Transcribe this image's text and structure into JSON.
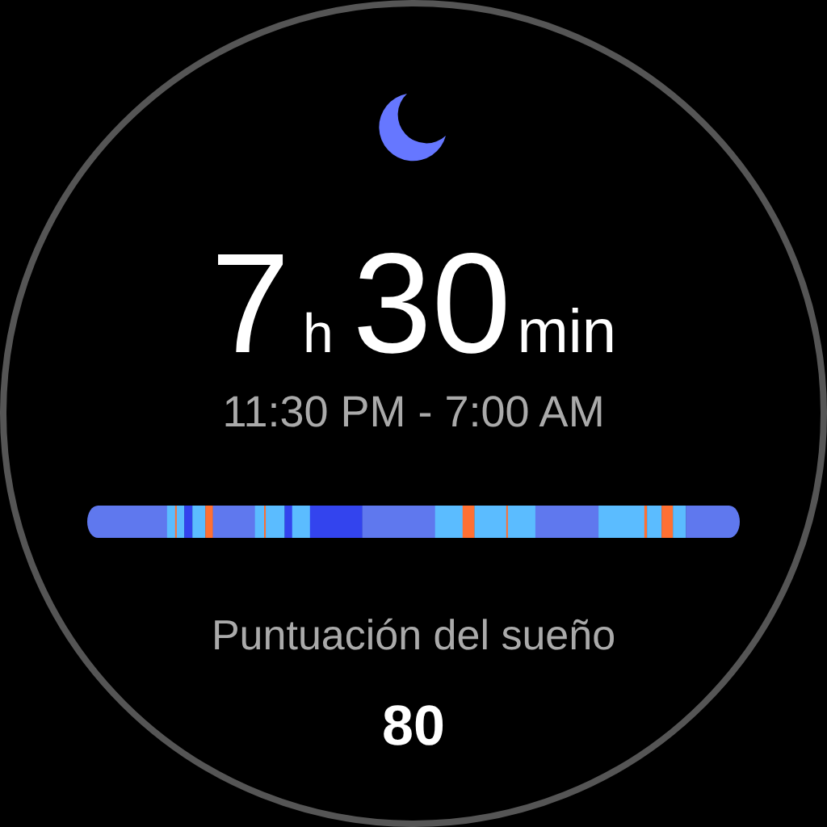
{
  "sleep": {
    "hours": "7",
    "hours_unit": "h",
    "minutes": "30",
    "minutes_unit": "min",
    "range": "11:30 PM - 7:00 AM"
  },
  "score": {
    "label": "Puntuación del sueño",
    "value": "80"
  }
}
